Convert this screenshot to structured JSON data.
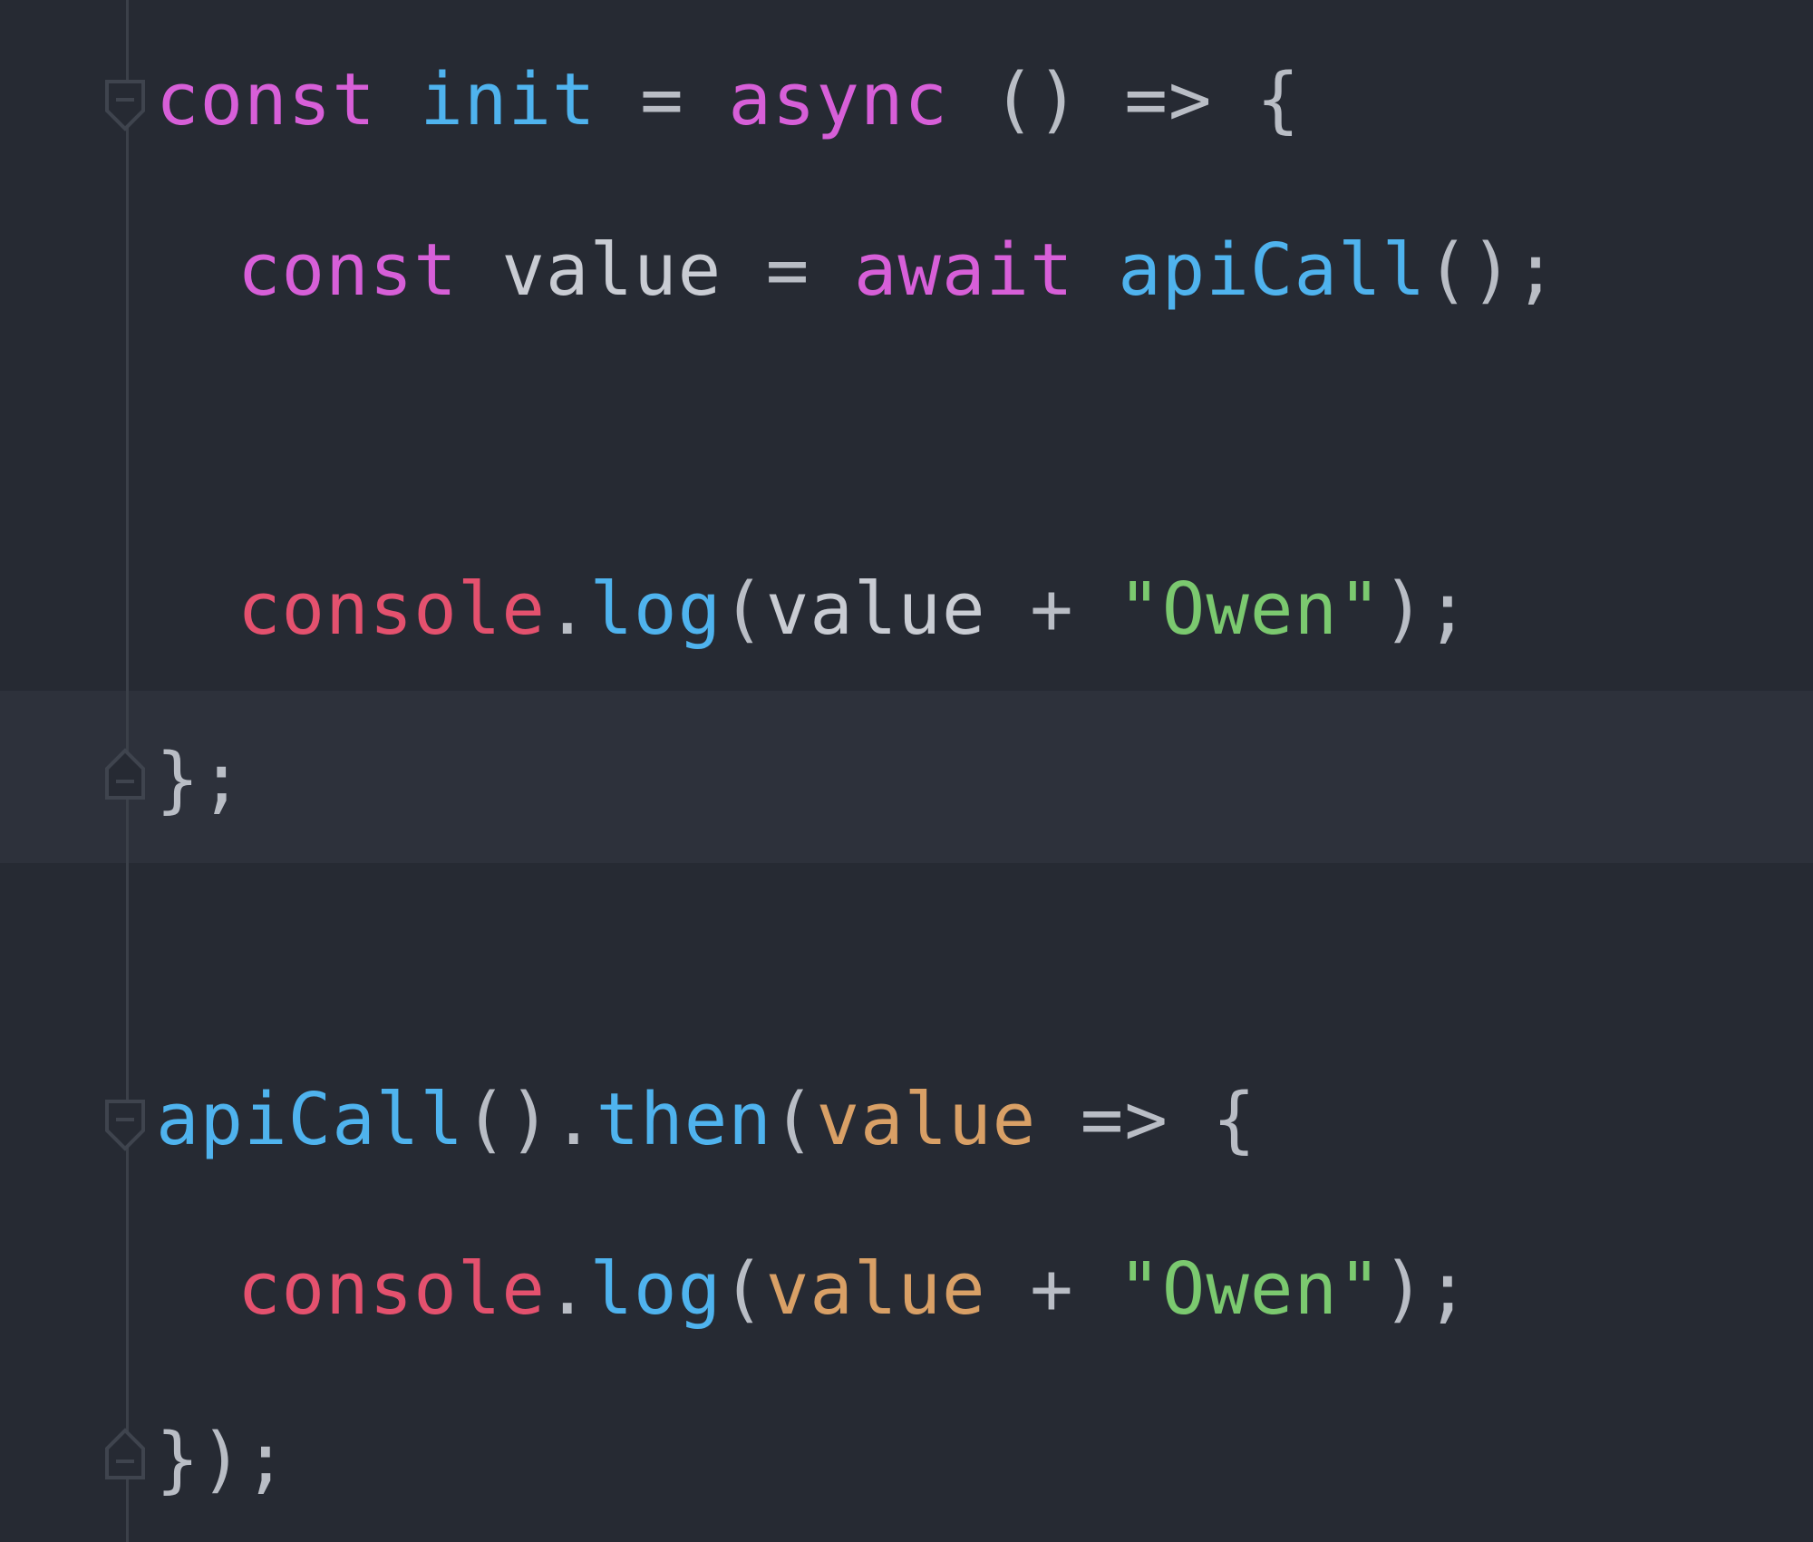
{
  "editor": {
    "colors": {
      "background": "#262a33",
      "current_line": "#2d313b",
      "guide": "#3b4049",
      "keyword": "#d75fd8",
      "function": "#4fb3ee",
      "identifier": "#c9ccd3",
      "punctuation": "#b9bdc5",
      "parameter": "#d9a066",
      "builtin": "#e4516e",
      "string": "#7bc96f"
    },
    "lines": [
      {
        "id": "line-1",
        "fold": "open",
        "tokens": [
          {
            "t": "const",
            "c": "keyword"
          },
          {
            "t": " ",
            "c": "punctuation"
          },
          {
            "t": "init",
            "c": "function"
          },
          {
            "t": " = ",
            "c": "punctuation"
          },
          {
            "t": "async",
            "c": "keyword"
          },
          {
            "t": " () => {",
            "c": "punctuation"
          }
        ]
      },
      {
        "id": "line-2",
        "tokens": [
          {
            "t": "const",
            "c": "keyword"
          },
          {
            "t": " ",
            "c": "punctuation"
          },
          {
            "t": "value",
            "c": "identifier"
          },
          {
            "t": " = ",
            "c": "punctuation"
          },
          {
            "t": "await",
            "c": "keyword"
          },
          {
            "t": " ",
            "c": "punctuation"
          },
          {
            "t": "apiCall",
            "c": "function"
          },
          {
            "t": "();",
            "c": "punctuation"
          }
        ]
      },
      {
        "id": "line-3",
        "tokens": [
          {
            "t": "console",
            "c": "builtin"
          },
          {
            "t": ".",
            "c": "punctuation"
          },
          {
            "t": "log",
            "c": "function"
          },
          {
            "t": "(",
            "c": "punctuation"
          },
          {
            "t": "value",
            "c": "identifier"
          },
          {
            "t": " + ",
            "c": "punctuation"
          },
          {
            "t": "\"Owen\"",
            "c": "string"
          },
          {
            "t": ");",
            "c": "punctuation"
          }
        ]
      },
      {
        "id": "line-4",
        "fold": "close",
        "tokens": [
          {
            "t": "};",
            "c": "punctuation"
          }
        ]
      },
      {
        "id": "line-5",
        "fold": "open",
        "tokens": [
          {
            "t": "apiCall",
            "c": "function"
          },
          {
            "t": "().",
            "c": "punctuation"
          },
          {
            "t": "then",
            "c": "function"
          },
          {
            "t": "(",
            "c": "punctuation"
          },
          {
            "t": "value",
            "c": "parameter"
          },
          {
            "t": " => {",
            "c": "punctuation"
          }
        ]
      },
      {
        "id": "line-6",
        "tokens": [
          {
            "t": "console",
            "c": "builtin"
          },
          {
            "t": ".",
            "c": "punctuation"
          },
          {
            "t": "log",
            "c": "function"
          },
          {
            "t": "(",
            "c": "punctuation"
          },
          {
            "t": "value",
            "c": "parameter"
          },
          {
            "t": " + ",
            "c": "punctuation"
          },
          {
            "t": "\"Owen\"",
            "c": "string"
          },
          {
            "t": ");",
            "c": "punctuation"
          }
        ]
      },
      {
        "id": "line-7",
        "fold": "close",
        "tokens": [
          {
            "t": "});",
            "c": "punctuation"
          }
        ]
      }
    ]
  }
}
